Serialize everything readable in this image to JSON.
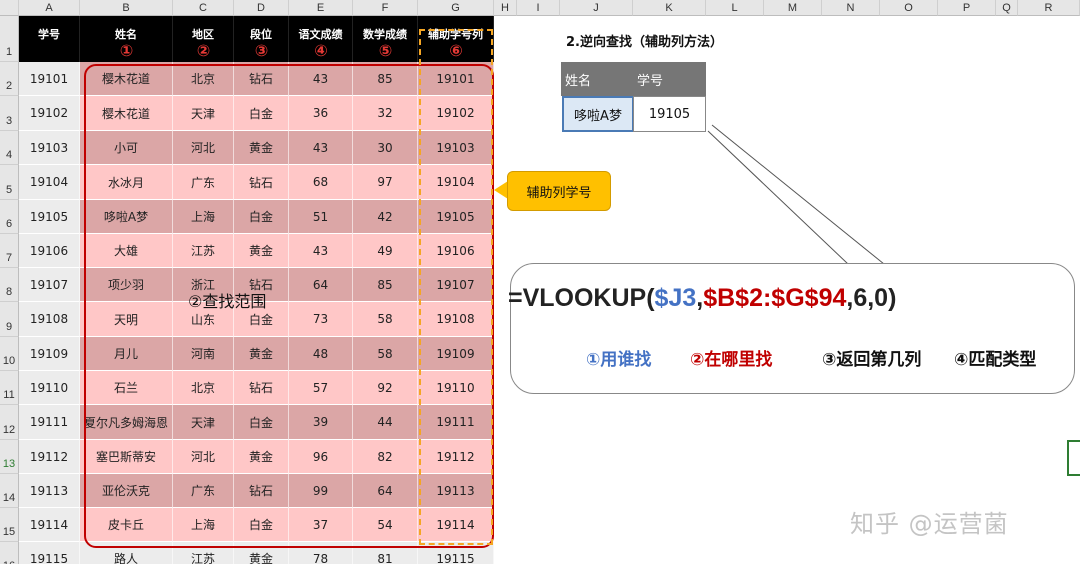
{
  "sheet": {
    "columns": [
      "A",
      "B",
      "C",
      "D",
      "E",
      "F",
      "G",
      "H",
      "I",
      "J",
      "K",
      "L",
      "M",
      "N",
      "O",
      "P",
      "Q",
      "R"
    ],
    "headers": [
      "学号",
      "姓名",
      "地区",
      "段位",
      "语文成绩",
      "数学成绩",
      "辅助学号列"
    ],
    "rows": [
      [
        "19101",
        "樱木花道",
        "北京",
        "钻石",
        "43",
        "85",
        "19101"
      ],
      [
        "19102",
        "樱木花道",
        "天津",
        "白金",
        "36",
        "32",
        "19102"
      ],
      [
        "19103",
        "小可",
        "河北",
        "黄金",
        "43",
        "30",
        "19103"
      ],
      [
        "19104",
        "水冰月",
        "广东",
        "钻石",
        "68",
        "97",
        "19104"
      ],
      [
        "19105",
        "哆啦A梦",
        "上海",
        "白金",
        "51",
        "42",
        "19105"
      ],
      [
        "19106",
        "大雄",
        "江苏",
        "黄金",
        "43",
        "49",
        "19106"
      ],
      [
        "19107",
        "项少羽",
        "浙江",
        "钻石",
        "64",
        "85",
        "19107"
      ],
      [
        "19108",
        "天明",
        "山东",
        "白金",
        "73",
        "58",
        "19108"
      ],
      [
        "19109",
        "月儿",
        "河南",
        "黄金",
        "48",
        "58",
        "19109"
      ],
      [
        "19110",
        "石兰",
        "北京",
        "钻石",
        "57",
        "92",
        "19110"
      ],
      [
        "19111",
        "夏尔凡多姆海恩",
        "天津",
        "白金",
        "39",
        "44",
        "19111"
      ],
      [
        "19112",
        "塞巴斯蒂安",
        "河北",
        "黄金",
        "96",
        "82",
        "19112"
      ],
      [
        "19113",
        "亚伦沃克",
        "广东",
        "钻石",
        "99",
        "64",
        "19113"
      ],
      [
        "19114",
        "皮卡丘",
        "上海",
        "白金",
        "37",
        "54",
        "19114"
      ],
      [
        "19115",
        "路人",
        "江苏",
        "黄金",
        "78",
        "81",
        "19115"
      ]
    ]
  },
  "annotations": {
    "circled": [
      "①",
      "②",
      "③",
      "④",
      "⑤",
      "⑥"
    ],
    "range_label": "②查找范围",
    "callout": "辅助列学号",
    "watermark": "知乎 @运营菌"
  },
  "lookup": {
    "title": "2.逆向查找（辅助列方法）",
    "headers": [
      "姓名",
      "学号"
    ],
    "values": [
      "哆啦A梦",
      "19105"
    ]
  },
  "formula": {
    "prefix": "=VLOOKUP(",
    "arg1": "$J3",
    "sep1": ",",
    "arg2": "$B$2:$G$94",
    "rest": ",6,0)",
    "labels": [
      "①用谁找",
      "②在哪里找",
      "③返回第几列",
      "④匹配类型"
    ],
    "colors": {
      "arg1": "#4472c4",
      "arg2": "#c00000",
      "rest": "#222222"
    }
  }
}
